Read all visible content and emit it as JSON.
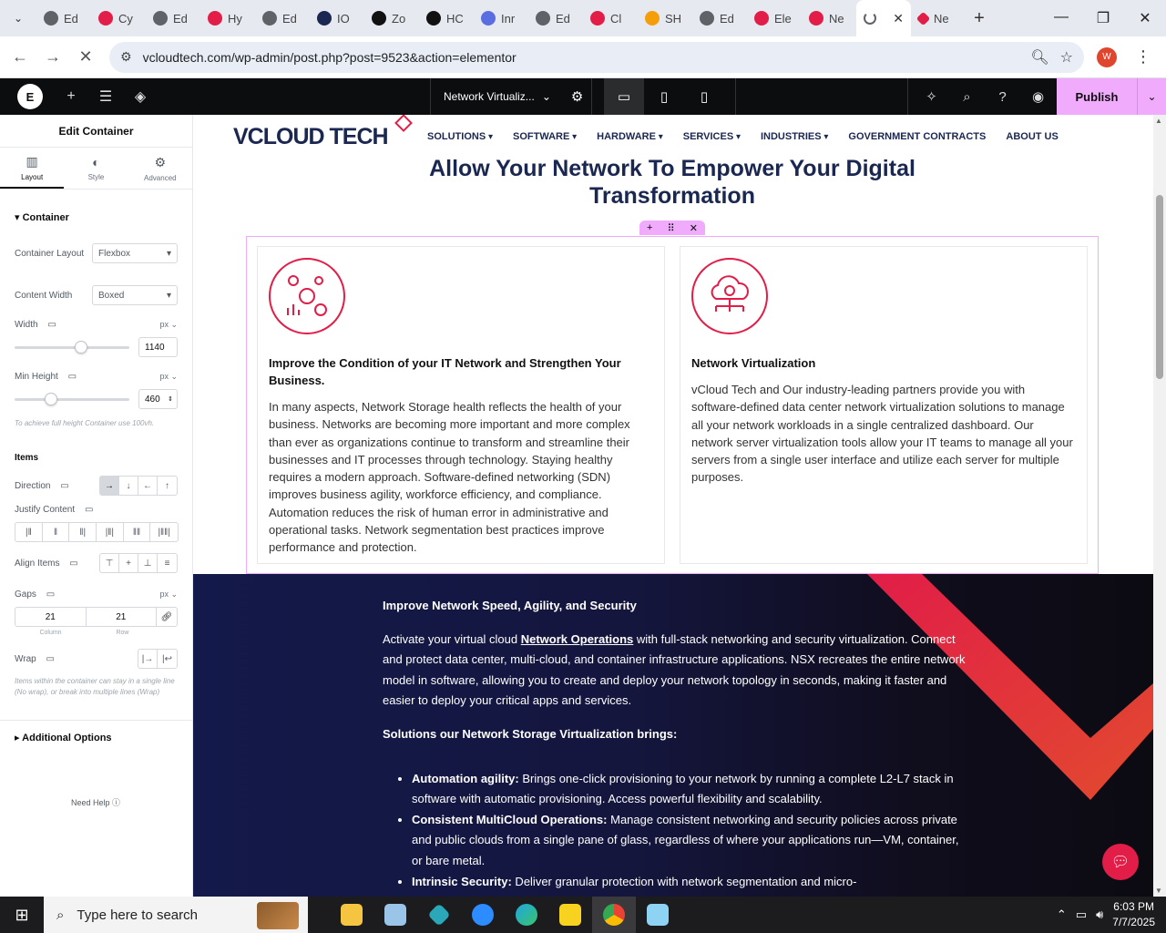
{
  "browser": {
    "tabs": [
      {
        "label": "Ed",
        "color": "#5f6368"
      },
      {
        "label": "Cy",
        "color": "#e11d48"
      },
      {
        "label": "Ed",
        "color": "#5f6368"
      },
      {
        "label": "Hy",
        "color": "#e11d48"
      },
      {
        "label": "Ed",
        "color": "#5f6368"
      },
      {
        "label": "IO",
        "color": "#1a2750"
      },
      {
        "label": "Zo",
        "color": "#111111"
      },
      {
        "label": "HC",
        "color": "#111111"
      },
      {
        "label": "Inr",
        "color": "#5b6ee1"
      },
      {
        "label": "Ed",
        "color": "#5f6368"
      },
      {
        "label": "Cl",
        "color": "#e11d48"
      },
      {
        "label": "SH",
        "color": "#f59e0b"
      },
      {
        "label": "Ed",
        "color": "#5f6368"
      },
      {
        "label": "Ele",
        "color": "#e11d48"
      },
      {
        "label": "Ne",
        "color": "#e11d48"
      }
    ],
    "active_tab": {
      "label": "",
      "close": "✕"
    },
    "last_tab": {
      "label": "Ne"
    },
    "url": "vcloudtech.com/wp-admin/post.php?post=9523&action=elementor",
    "profile_initial": "W"
  },
  "editor": {
    "doc_title": "Network Virtualiz...",
    "publish_label": "Publish"
  },
  "panel": {
    "title": "Edit Container",
    "tabs": [
      "Layout",
      "Style",
      "Advanced"
    ],
    "section_title": "Container",
    "container_layout_label": "Container Layout",
    "container_layout_value": "Flexbox",
    "content_width_label": "Content Width",
    "content_width_value": "Boxed",
    "width_label": "Width",
    "width_unit": "px",
    "width_value": "1140",
    "width_fraction": 0.58,
    "min_height_label": "Min Height",
    "min_height_unit": "px",
    "min_height_value": "460",
    "min_height_fraction": 0.32,
    "full_height_note": "To achieve full height Container use 100vh.",
    "items_title": "Items",
    "direction_label": "Direction",
    "justify_label": "Justify Content",
    "align_label": "Align Items",
    "gaps_label": "Gaps",
    "gaps_unit": "px",
    "gap_column": "21",
    "gap_row": "21",
    "gap_column_label": "Column",
    "gap_row_label": "Row",
    "wrap_label": "Wrap",
    "wrap_note": "Items within the container can stay in a single line (No wrap), or break into multiple lines (Wrap)",
    "additional_options": "Additional Options",
    "need_help": "Need Help"
  },
  "site": {
    "logo_left": "VCLOUD",
    "logo_right": "TECH",
    "nav": [
      {
        "label": "SOLUTIONS",
        "dd": true
      },
      {
        "label": "SOFTWARE",
        "dd": true
      },
      {
        "label": "HARDWARE",
        "dd": true
      },
      {
        "label": "SERVICES",
        "dd": true
      },
      {
        "label": "INDUSTRIES",
        "dd": true
      },
      {
        "label": "GOVERNMENT CONTRACTS",
        "dd": false
      },
      {
        "label": "ABOUT US",
        "dd": false
      }
    ],
    "hero_title": "Allow Your Network To Empower Your Digital Transformation",
    "card1": {
      "title": "Improve the Condition of your IT Network and Strengthen Your Business.",
      "body": "In many aspects, Network Storage health reflects the health of your business. Networks are becoming more important and more complex than ever as organizations continue to transform and streamline their businesses and IT processes through technology. Staying healthy requires a modern approach. Software-defined networking (SDN) improves business agility, workforce efficiency, and compliance. Automation reduces the risk of human error in administrative and operational tasks. Network segmentation best practices improve performance and protection."
    },
    "card2": {
      "title": "Network Virtualization",
      "body": "vCloud Tech and Our industry-leading partners provide you with software-defined data center network virtualization solutions to manage all your network workloads in a single centralized dashboard. Our network server virtualization tools allow your IT teams to manage all your servers from a single user interface and utilize each server for multiple purposes."
    },
    "dark": {
      "heading": "Improve Network Speed, Agility, and Security",
      "para_before": " Activate your virtual cloud ",
      "para_link": "Network Operations",
      "para_after": " with full-stack networking and security virtualization. Connect and protect data center, multi-cloud, and container infrastructure applications. NSX recreates the entire network model in software, allowing you to create and deploy your network topology in seconds, making it faster and easier to deploy your critical apps and services.",
      "subheading": "Solutions our Network Storage Virtualization brings:",
      "bullets": [
        {
          "bold": "Automation agility:",
          "text": " Brings one-click provisioning to your network by running a complete L2-L7 stack in software with automatic provisioning. Access powerful flexibility and scalability."
        },
        {
          "bold": "Consistent MultiCloud Operations:",
          "text": " Manage consistent networking and security policies across private and public clouds from a single pane of glass, regardless of where your applications run—VM, container, or bare metal."
        },
        {
          "bold": "Intrinsic Security:",
          "text": " Deliver granular protection with network segmentation and micro-"
        }
      ]
    }
  },
  "taskbar": {
    "search_placeholder": "Type here to search",
    "time": "6:03 PM",
    "date": "7/7/2025"
  },
  "colors": {
    "accent": "#f0abfc",
    "brand_red": "#e11d48",
    "navy": "#1a2750"
  }
}
